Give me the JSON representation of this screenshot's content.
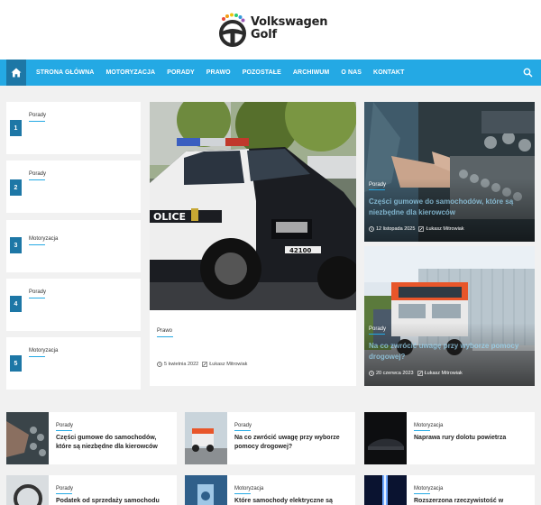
{
  "brand": {
    "line1": "Volkswagen",
    "line2": "Golf"
  },
  "nav": {
    "home_icon": "home-icon",
    "items": [
      "STRONA GŁÓWNA",
      "MOTORYZACJA",
      "PORADY",
      "PRAWO",
      "POZOSTAŁE",
      "ARCHIWUM",
      "O NAS",
      "KONTAKT"
    ],
    "search_icon": "search-icon"
  },
  "numbered": [
    {
      "num": "1",
      "category": "Porady"
    },
    {
      "num": "2",
      "category": "Porady"
    },
    {
      "num": "3",
      "category": "Motoryzacja"
    },
    {
      "num": "4",
      "category": "Porady"
    },
    {
      "num": "5",
      "category": "Motoryzacja"
    }
  ],
  "feature": {
    "category": "Prawo",
    "date": "5 kwietnia 2022",
    "author": "Łukasz Mitrowiak"
  },
  "right_cards": [
    {
      "category": "Porady",
      "title": "Części gumowe do samochodów, które są niezbędne dla kierowców",
      "date": "12 listopada 2025",
      "author": "Łukasz Mitrowiak"
    },
    {
      "category": "Porady",
      "title": "Na co zwrócić uwagę przy wyborze pomocy drogowej?",
      "date": "20 czerwca 2023",
      "author": "Łukasz Mitrowiak"
    }
  ],
  "bottom": [
    {
      "category": "Porady",
      "title": "Części gumowe do samochodów, które są niezbędne dla kierowców"
    },
    {
      "category": "Porady",
      "title": "Na co zwrócić uwagę przy wyborze pomocy drogowej?"
    },
    {
      "category": "Motoryzacja",
      "title": "Naprawa rury dolotu powietrza"
    },
    {
      "category": "Porady",
      "title": "Podatek od sprzedaży samochodu"
    },
    {
      "category": "Motoryzacja",
      "title": "Które samochody elektryczne są"
    },
    {
      "category": "Motoryzacja",
      "title": "Rozszerzona rzeczywistość w"
    }
  ],
  "colors": {
    "accent": "#24a9e4",
    "dark_accent": "#1d77a6",
    "background": "#f1f1f1"
  }
}
